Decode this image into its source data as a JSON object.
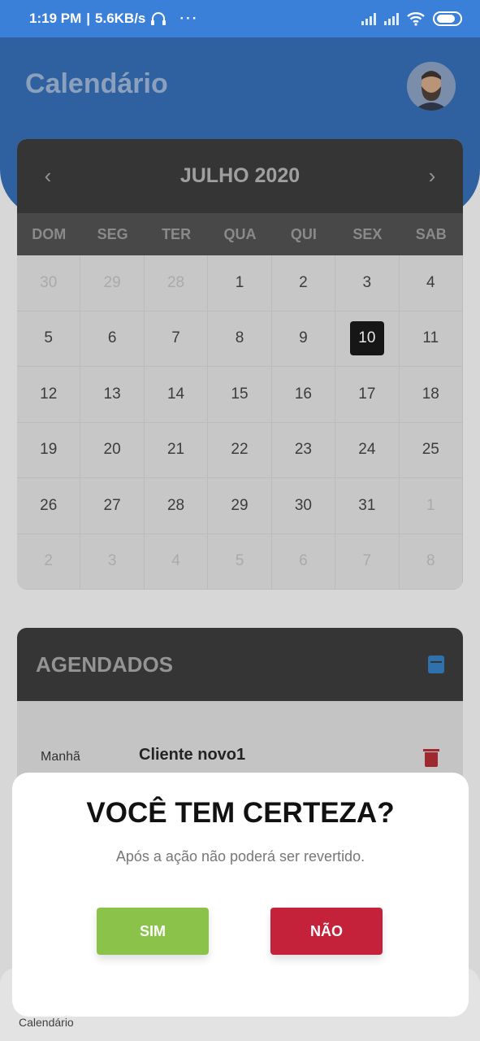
{
  "status_bar": {
    "time": "1:19 PM",
    "speed": "5.6KB/s",
    "dots": "···"
  },
  "header": {
    "title": "Calendário"
  },
  "calendar": {
    "month": "JULHO 2020",
    "prev_icon": "chevron-left-icon",
    "next_icon": "chevron-right-icon",
    "weekdays": [
      "DOM",
      "SEG",
      "TER",
      "QUA",
      "QUI",
      "SEX",
      "SAB"
    ],
    "days": [
      {
        "label": "30",
        "muted": true
      },
      {
        "label": "29",
        "muted": true
      },
      {
        "label": "28",
        "muted": true
      },
      {
        "label": "1"
      },
      {
        "label": "2"
      },
      {
        "label": "3"
      },
      {
        "label": "4"
      },
      {
        "label": "5"
      },
      {
        "label": "6"
      },
      {
        "label": "7"
      },
      {
        "label": "8"
      },
      {
        "label": "9"
      },
      {
        "label": "10",
        "selected": true
      },
      {
        "label": "11"
      },
      {
        "label": "12"
      },
      {
        "label": "13"
      },
      {
        "label": "14"
      },
      {
        "label": "15"
      },
      {
        "label": "16"
      },
      {
        "label": "17"
      },
      {
        "label": "18"
      },
      {
        "label": "19"
      },
      {
        "label": "20"
      },
      {
        "label": "21"
      },
      {
        "label": "22"
      },
      {
        "label": "23"
      },
      {
        "label": "24"
      },
      {
        "label": "25"
      },
      {
        "label": "26"
      },
      {
        "label": "27"
      },
      {
        "label": "28"
      },
      {
        "label": "29"
      },
      {
        "label": "30"
      },
      {
        "label": "31"
      },
      {
        "label": "1",
        "muted": true
      },
      {
        "label": "2",
        "muted": true
      },
      {
        "label": "3",
        "muted": true
      },
      {
        "label": "4",
        "muted": true
      },
      {
        "label": "5",
        "muted": true
      },
      {
        "label": "6",
        "muted": true
      },
      {
        "label": "7",
        "muted": true
      },
      {
        "label": "8",
        "muted": true
      }
    ]
  },
  "agenda": {
    "title": "AGENDADOS",
    "icon": "calendar-add-icon",
    "items": [
      {
        "period": "Manhã",
        "client": "Cliente novo1",
        "delete_icon": "trash-icon"
      }
    ]
  },
  "modal": {
    "title": "VOCÊ TEM CERTEZA?",
    "message": "Após a ação não poderá ser revertido.",
    "confirm_label": "SIM",
    "cancel_label": "NÃO"
  },
  "bottom_nav": {
    "label": "Calendário"
  },
  "colors": {
    "confirm": "#8bc34a",
    "cancel": "#c4213b",
    "selected_day": "#000000",
    "header": "#1f5ca9"
  }
}
